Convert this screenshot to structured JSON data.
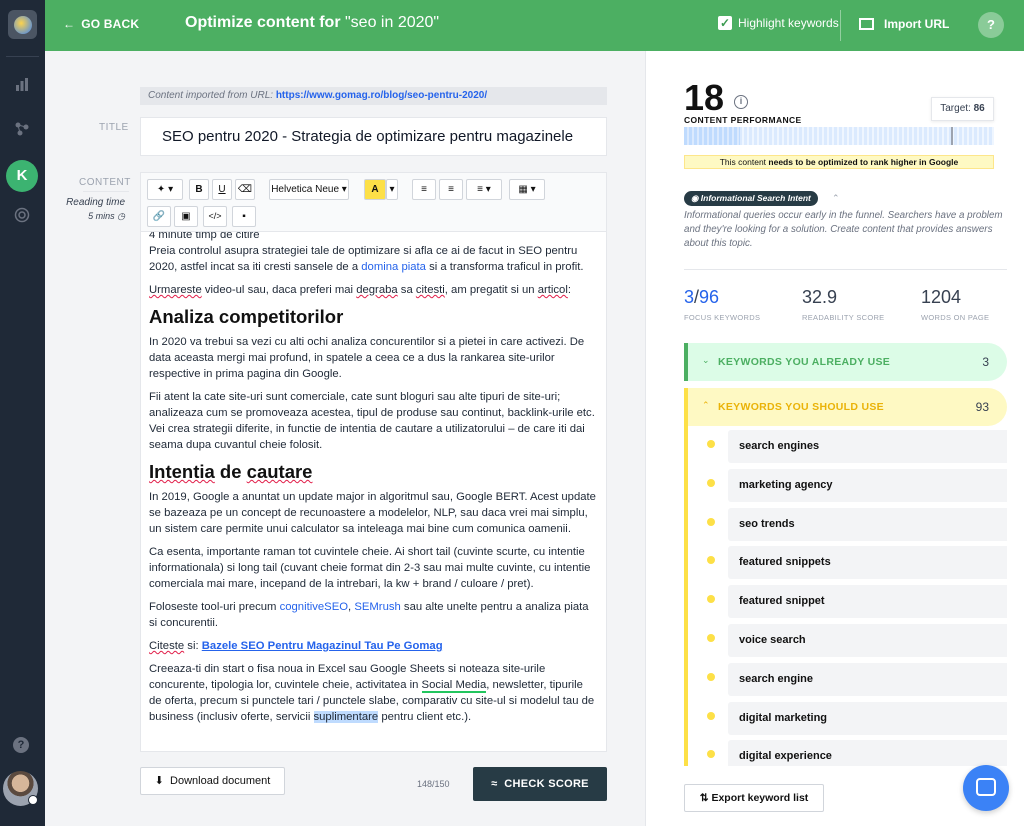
{
  "topbar": {
    "back_label": "GO BACK",
    "title_prefix": "Optimize content for ",
    "title_query": "\"seo in 2020\"",
    "highlight_label": "Highlight keywords",
    "import_label": "Import URL",
    "help": "?"
  },
  "editor": {
    "imported_prefix": "Content imported from URL: ",
    "imported_url": "https://www.gomag.ro/blog/seo-pentru-2020/",
    "title_label": "TITLE",
    "title_value": "SEO pentru 2020 - Strategia de optimizare pentru magazinele",
    "content_label": "CONTENT",
    "reading_time_label": "Reading time",
    "reading_time_value": "5 mins",
    "toolbar": {
      "font": "Helvetica Neue",
      "bold": "B",
      "underline": "U",
      "font_color": "A"
    },
    "body": {
      "l0": "4 minute timp de citire",
      "p1a": "Preia controlul asupra strategiei tale de optimizare si afla ce ai de facut in  SEO pentru 2020, astfel incat sa iti cresti sansele de a ",
      "p1link": "domina piata",
      "p1b": " si a transforma traficul in profit.",
      "p2a": "Urmareste",
      "p2b": " video-ul sau, daca preferi mai ",
      "p2c": "degraba",
      "p2d": " sa ",
      "p2e": "citesti",
      "p2f": ", am pregatit si un ",
      "p2g": "articol",
      "p2h": ":",
      "h1": "Analiza competitorilor",
      "p3": "In 2020 va trebui sa vezi cu alti ochi analiza concurentilor si a pietei in care activezi. De data aceasta mergi mai profund, in spatele a ceea ce a dus la rankarea site-urilor respective in prima pagina din Google.",
      "p4": "Fii atent la cate site-uri sunt comerciale, cate sunt bloguri sau alte tipuri de site-uri; analizeaza cum se promoveaza acestea, tipul de produse sau continut, backlink-urile etc. Vei crea strategii diferite, in functie de intentia de cautare a utilizatorului – de care iti dai seama dupa cuvantul cheie folosit.",
      "h2a": "Intentia",
      "h2b": " de ",
      "h2c": "cautare",
      "p5": "In 2019, Google a anuntat un update major in algoritmul sau, Google BERT. Acest update se bazeaza pe un concept de recunoastere a modelelor, NLP, sau daca vrei mai simplu, un sistem care permite unui calculator sa inteleaga mai bine cum comunica oamenii.",
      "p6": "Ca esenta, importante raman tot cuvintele cheie. Ai short tail (cuvinte scurte, cu intentie informationala) si long tail (cuvant cheie format din 2-3 sau mai multe cuvinte, cu intentie comerciala mai mare, incepand de la intrebari, la kw + brand / culoare / pret).",
      "p7a": "Foloseste tool-uri precum ",
      "p7l1": "cognitiveSEO",
      "p7b": ", ",
      "p7l2": "SEMrush",
      "p7c": " sau alte unelte pentru a analiza piata si concurentii.",
      "p8a": "Citeste",
      "p8b": " si: ",
      "p8link": "Bazele SEO Pentru Magazinul Tau Pe Gomag",
      "p9a": "Creeaza-ti din start o fisa noua in Excel sau Google Sheets si noteaza site-urile concurente, tipologia lor, cuvintele cheie, activitatea in ",
      "p9h1": "Social Media",
      "p9b": ", newsletter, tipurile de oferta, precum si punctele tari / punctele slabe, comparativ cu site-ul si modelul tau de business (inclusiv oferte, servicii ",
      "p9h2": "suplimentare",
      "p9c": " pentru client etc.)."
    },
    "download_label": "Download document",
    "char_count": "148/150",
    "check_label": "CHECK SCORE"
  },
  "panel": {
    "score": "18",
    "score_label": "CONTENT PERFORMANCE",
    "target_label": "Target: ",
    "target_value": "86",
    "score_fraction": 0.18,
    "target_fraction": 0.86,
    "warning_prefix": "This content ",
    "warning_bold": "needs to be optimized to rank higher in Google",
    "intent_label": "Informational Search Intent",
    "intent_desc": "Informational queries occur early in the funnel. Searchers have a problem and they're looking for a solution. Create content that provides answers about this topic.",
    "focus_have": "3",
    "focus_total": "96",
    "focus_label": "FOCUS KEYWORDS",
    "readability": "32.9",
    "readability_label": "READABILITY SCORE",
    "words": "1204",
    "words_label": "WORDS ON PAGE",
    "used_label": "KEYWORDS YOU ALREADY USE",
    "used_count": "3",
    "should_label": "KEYWORDS YOU SHOULD USE",
    "should_count": "93",
    "keywords": [
      "search engines",
      "marketing agency",
      "seo trends",
      "featured snippets",
      "featured snippet",
      "voice search",
      "search engine",
      "digital marketing",
      "digital experience"
    ],
    "export_label": "Export keyword list"
  },
  "colors": {
    "brand_green": "#4caf62",
    "dark": "#273b45",
    "keyword_yellow": "#fde047",
    "link_blue": "#2563eb"
  }
}
